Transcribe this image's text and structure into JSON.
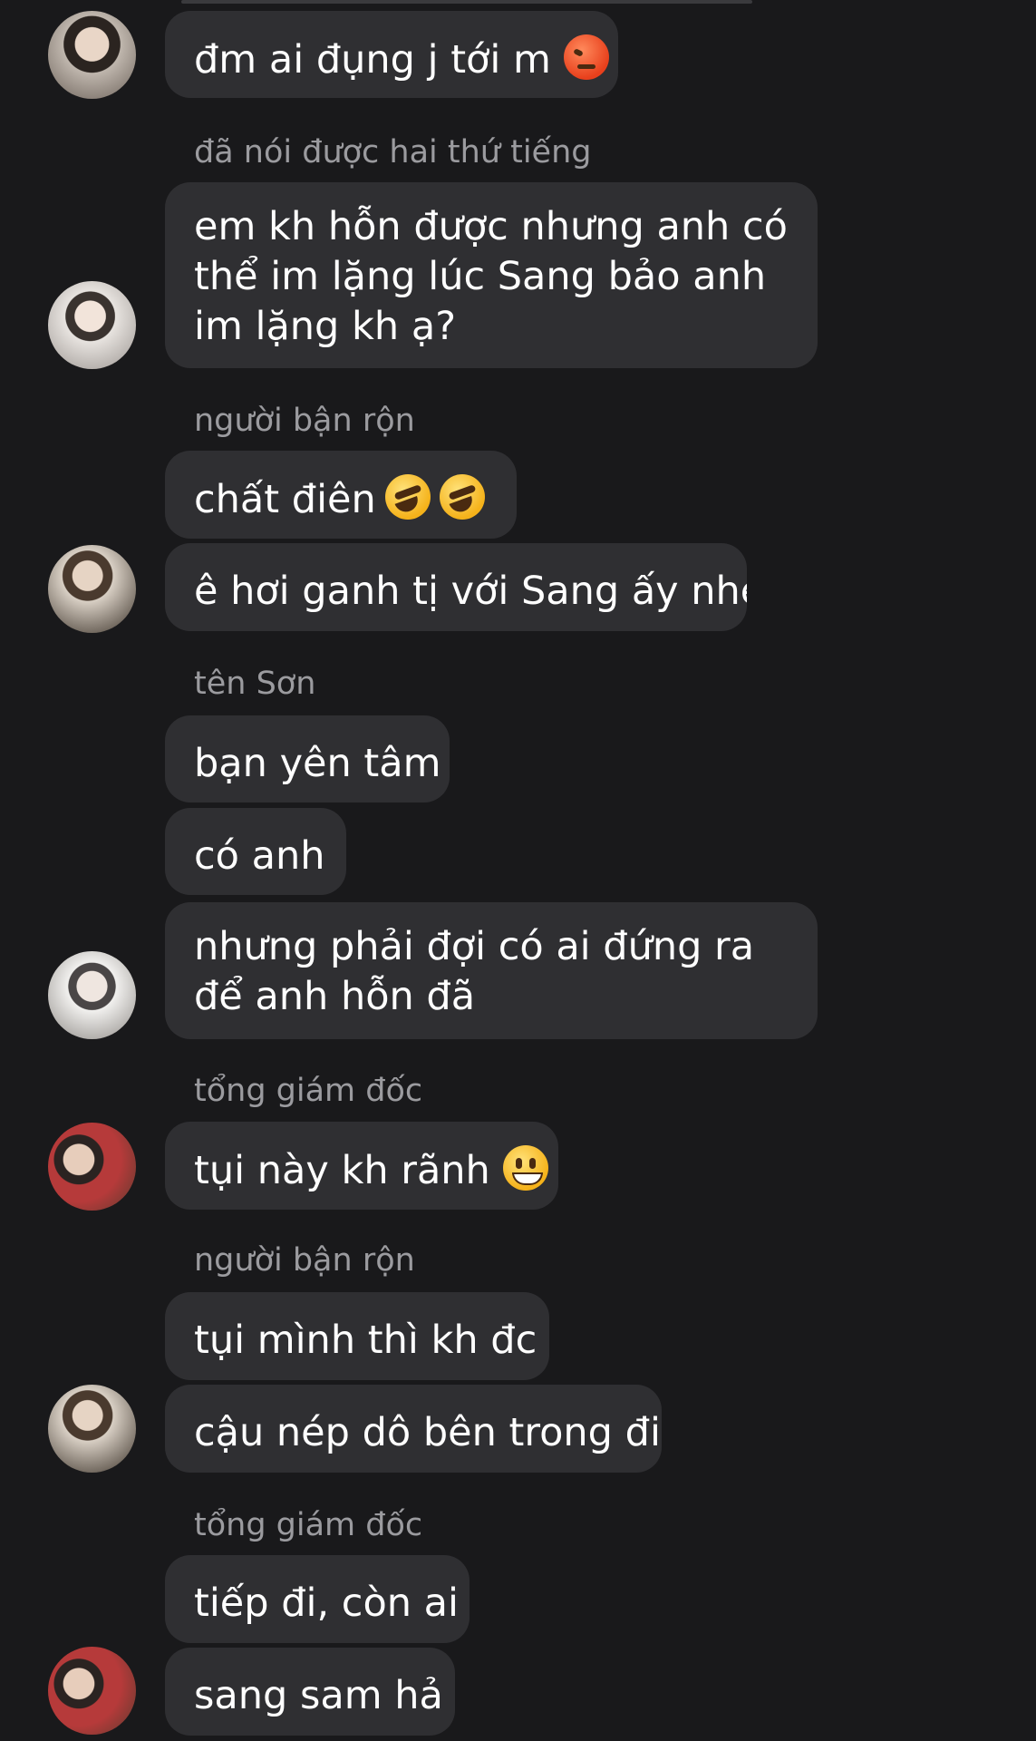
{
  "messages": [
    {
      "sender": "",
      "text": "đm ai đụng j tới m",
      "emoji": "angry-face-emoji"
    },
    {
      "sender": "đã nói được hai thứ tiếng",
      "text": "em kh hỗn được nhưng anh có thể im lặng lúc Sang bảo anh im lặng kh ạ?"
    },
    {
      "sender": "người bận rộn",
      "text": "chất điên",
      "emoji": "rolling-on-floor-laughing-emoji"
    },
    {
      "sender": "",
      "text": "ê hơi ganh tị với Sang ấy nhé"
    },
    {
      "sender": "tên Sơn",
      "text": "bạn yên tâm"
    },
    {
      "sender": "",
      "text": "có anh"
    },
    {
      "sender": "",
      "text": "nhưng phải đợi có ai đứng ra để anh hỗn đã"
    },
    {
      "sender": "tổng giám đốc",
      "text": "tụi này kh rãnh",
      "emoji": "grinning-face-emoji"
    },
    {
      "sender": "người bận rộn",
      "text": "tụi mình thì kh đc"
    },
    {
      "sender": "",
      "text": "cậu nép dô bên trong đi"
    },
    {
      "sender": "tổng giám đốc",
      "text": "tiếp đi, còn ai"
    },
    {
      "sender": "",
      "text": "sang sam hả"
    }
  ],
  "colors": {
    "background": "#19191b",
    "bubble": "#2f2f32",
    "sender_name": "#9b9b9f",
    "message_text": "#ffffff"
  }
}
